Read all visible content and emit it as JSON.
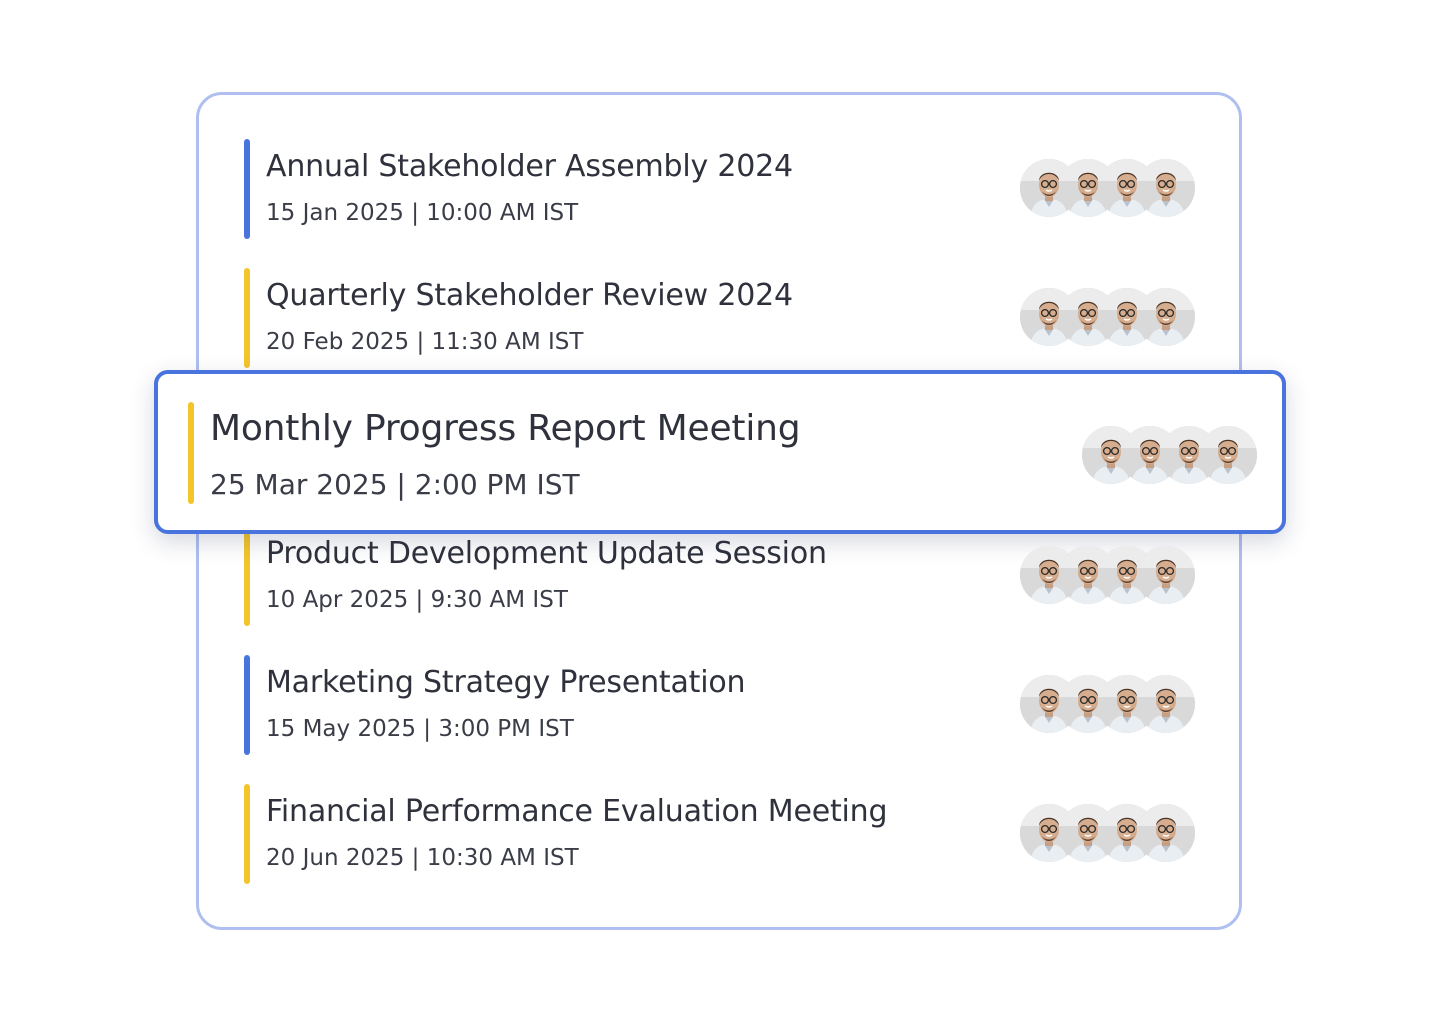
{
  "colors": {
    "blue_accent": "#4a74dd",
    "yellow_accent": "#f4c52b",
    "card_border": "#aebff0"
  },
  "meetings": [
    {
      "title": "Annual Stakeholder Assembly 2024",
      "meta": "15 Jan 2025 | 10:00 AM IST",
      "accent": "#4a74dd",
      "avatars": [
        "person-avatar",
        "person-avatar",
        "person-avatar",
        "person-avatar"
      ]
    },
    {
      "title": "Quarterly Stakeholder Review 2024",
      "meta": "20 Feb 2025 | 11:30 AM IST",
      "accent": "#f4c52b",
      "avatars": [
        "person-avatar",
        "person-avatar",
        "person-avatar",
        "person-avatar"
      ]
    },
    {
      "title": "Monthly Progress Report Meeting",
      "meta": "25 Mar 2025 | 2:00 PM IST",
      "accent": "#f4c52b",
      "highlighted": true,
      "avatars": [
        "person-avatar",
        "person-avatar",
        "person-avatar",
        "person-avatar"
      ]
    },
    {
      "title": "Product Development Update Session",
      "meta": "10 Apr 2025 | 9:30 AM IST",
      "accent": "#f4c52b",
      "avatars": [
        "person-avatar",
        "person-avatar",
        "person-avatar",
        "person-avatar"
      ]
    },
    {
      "title": "Marketing Strategy Presentation",
      "meta": "15 May 2025 | 3:00 PM IST",
      "accent": "#4a74dd",
      "avatars": [
        "person-avatar",
        "person-avatar",
        "person-avatar",
        "person-avatar"
      ]
    },
    {
      "title": "Financial Performance Evaluation Meeting",
      "meta": "20 Jun 2025 | 10:30 AM IST",
      "accent": "#f4c52b",
      "avatars": [
        "person-avatar",
        "person-avatar",
        "person-avatar",
        "person-avatar"
      ]
    }
  ]
}
